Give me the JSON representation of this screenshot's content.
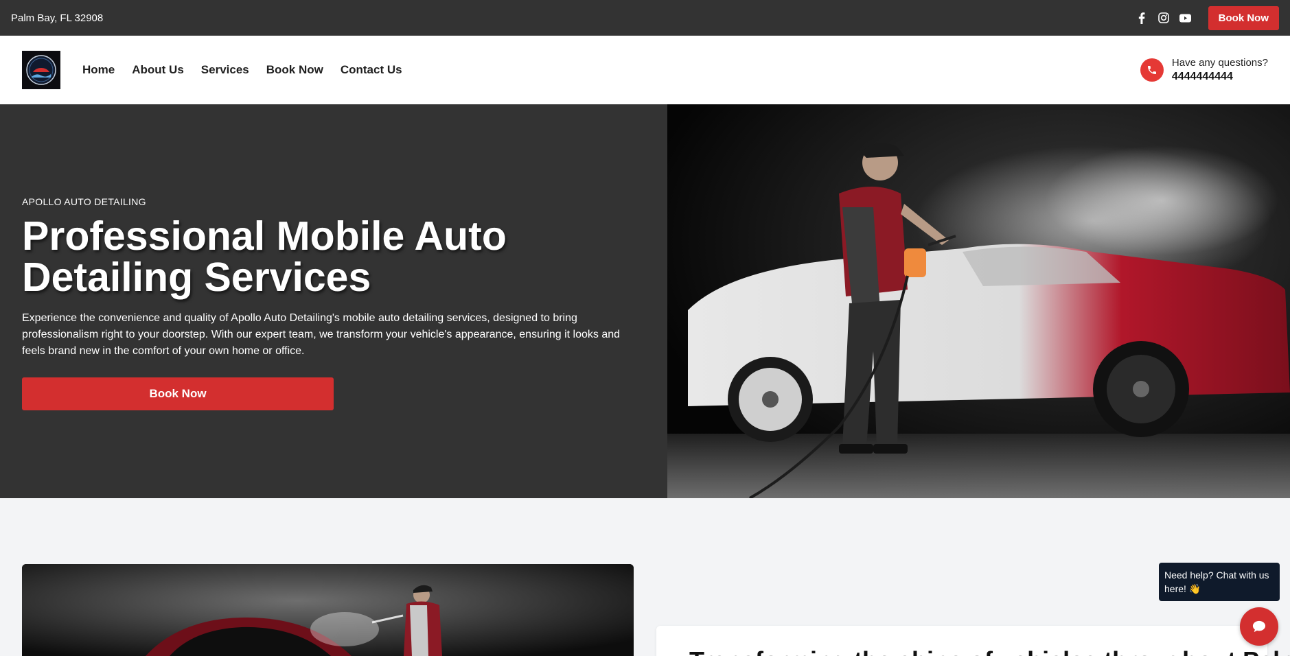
{
  "topbar": {
    "location": "Palm Bay, FL 32908",
    "social": [
      "facebook-icon",
      "instagram-icon",
      "youtube-icon"
    ],
    "book_label": "Book Now"
  },
  "nav": {
    "logo_alt": "Apollo Auto Detailing logo",
    "items": [
      "Home",
      "About Us",
      "Services",
      "Book Now",
      "Contact Us"
    ],
    "question": "Have any questions?",
    "phone": "4444444444"
  },
  "hero": {
    "eyebrow": "APOLLO AUTO DETAILING",
    "title": "Professional Mobile Auto Detailing Services",
    "description": "Experience the convenience and quality of Apollo Auto Detailing's mobile auto detailing services, designed to bring professionalism right to your doorstep. With our expert team, we transform your vehicle's appearance, ensuring it looks and feels brand new in the comfort of your own home or office.",
    "button": "Book Now"
  },
  "section2": {
    "title": "Transforming the shine of vehicles throughout Palm B"
  },
  "chat": {
    "message": "Need help? Chat with us here! 👋"
  },
  "colors": {
    "accent": "#d32f2f",
    "dark": "#333333",
    "chat_bg": "#0f1a2b"
  }
}
